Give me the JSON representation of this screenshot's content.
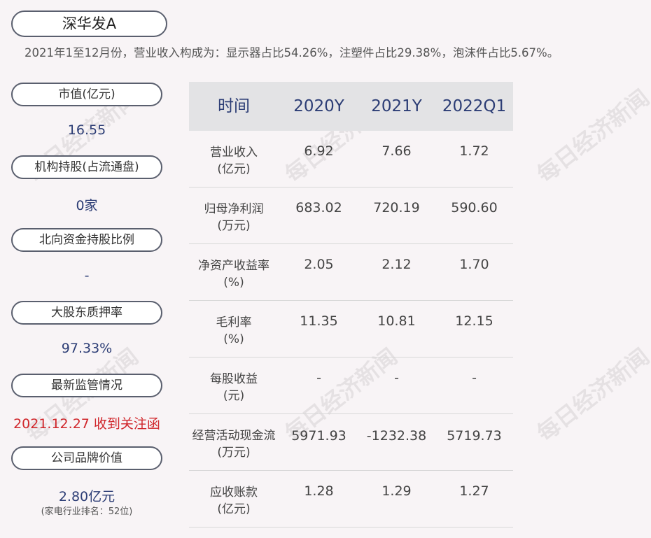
{
  "title": "深华发A",
  "summary": "2021年1至12月份，营业收入构成为：显示器占比54.26%，注塑件占比29.38%，泡沫件占比5.67%。",
  "sidebar": {
    "market_cap": {
      "label": "市值(亿元)",
      "value": "16.55"
    },
    "institutional": {
      "label": "机构持股(占流通盘)",
      "value": "0家"
    },
    "northbound": {
      "label": "北向资金持股比例",
      "value": "-"
    },
    "pledge": {
      "label": "大股东质押率",
      "value": "97.33%"
    },
    "regulation": {
      "label": "最新监管情况",
      "value": "2021.12.27 收到关注函"
    },
    "brand": {
      "label": "公司品牌价值",
      "value": "2.80亿元",
      "note": "(家电行业排名：52位)"
    }
  },
  "table": {
    "headers": [
      "时间",
      "2020Y",
      "2021Y",
      "2022Q1"
    ],
    "rows": [
      {
        "label1": "营业收入",
        "label2": "(亿元)",
        "values": [
          "6.92",
          "7.66",
          "1.72"
        ]
      },
      {
        "label1": "归母净利润",
        "label2": "(万元)",
        "values": [
          "683.02",
          "720.19",
          "590.60"
        ]
      },
      {
        "label1": "净资产收益率",
        "label2": "(%)",
        "values": [
          "2.05",
          "2.12",
          "1.70"
        ]
      },
      {
        "label1": "毛利率",
        "label2": "(%)",
        "values": [
          "11.35",
          "10.81",
          "12.15"
        ]
      },
      {
        "label1": "每股收益",
        "label2": "(元)",
        "values": [
          "-",
          "-",
          "-"
        ]
      },
      {
        "label1": "经营活动现金流",
        "label2": "(万元)",
        "values": [
          "5971.93",
          "-1232.38",
          "5719.73"
        ]
      },
      {
        "label1": "应收账款",
        "label2": "(亿元)",
        "values": [
          "1.28",
          "1.29",
          "1.27"
        ]
      }
    ]
  },
  "watermark": "每日经济新闻"
}
